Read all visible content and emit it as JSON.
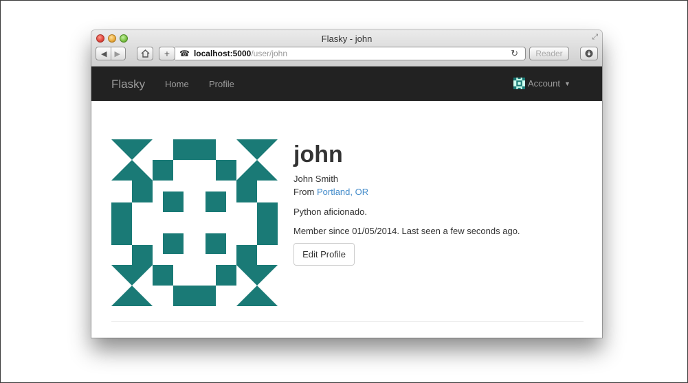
{
  "window": {
    "title": "Flasky - john"
  },
  "toolbar": {
    "back_icon": "back-arrow-icon",
    "forward_icon": "forward-arrow-icon",
    "home_icon": "home-icon",
    "add_icon": "plus-icon",
    "url_host": "localhost:5000",
    "url_path": "/user/john",
    "reader_label": "Reader",
    "reload_icon": "reload-icon",
    "download_icon": "download-icon"
  },
  "navbar": {
    "brand": "Flasky",
    "links": [
      "Home",
      "Profile"
    ],
    "account_label": "Account",
    "background": "#222222",
    "text_color": "#9d9d9d"
  },
  "profile": {
    "username": "john",
    "full_name": "John Smith",
    "location_prefix": "From",
    "location": "Portland, OR",
    "about": "Python aficionado.",
    "member_since": "Member since 01/05/2014. Last seen a few seconds ago.",
    "edit_button": "Edit Profile",
    "avatar_color": "#1a7a76",
    "link_color": "#428bca"
  }
}
